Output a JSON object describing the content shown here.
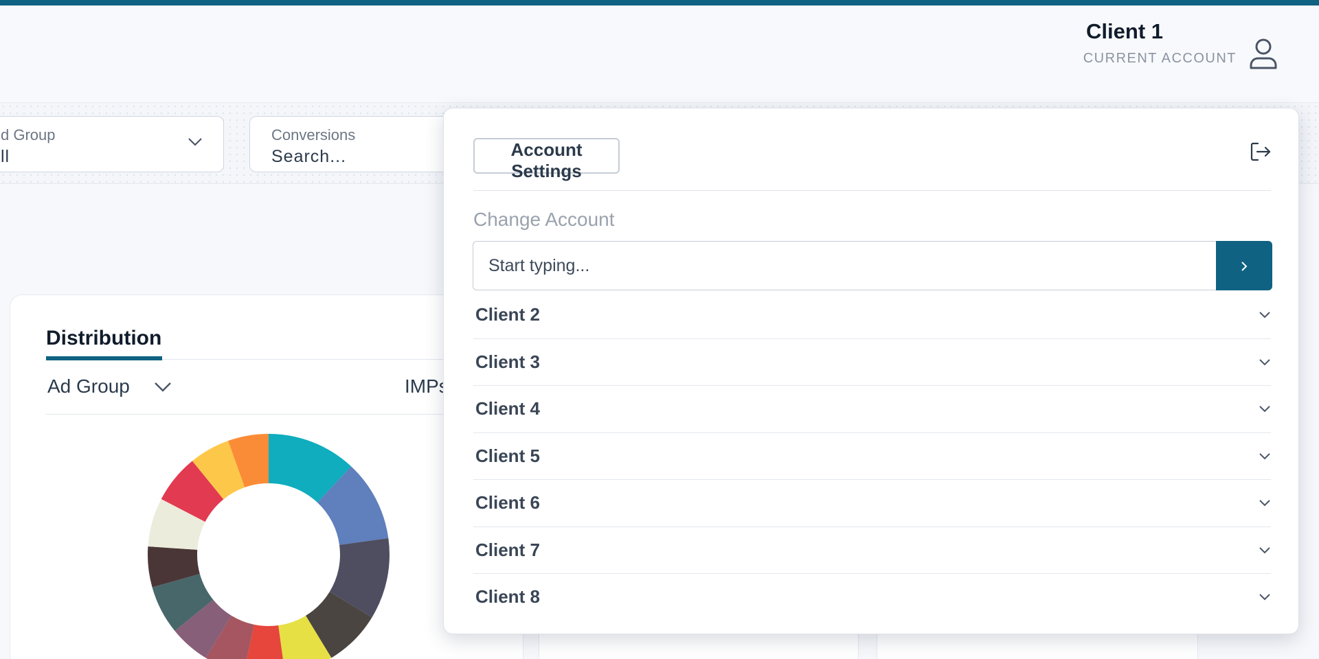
{
  "header": {
    "account_name": "Client 1",
    "account_caption": "CURRENT ACCOUNT",
    "user_icon": "user-icon"
  },
  "filters": {
    "ad_group": {
      "label": "d Group",
      "value": "ll"
    },
    "conversions": {
      "label": "Conversions",
      "placeholder": "Search..."
    }
  },
  "distribution": {
    "title": "Distribution",
    "group_by": "Ad Group",
    "metric_label": "IMPs",
    "chart_data": {
      "type": "pie",
      "hole": true,
      "slices": [
        {
          "value": 11,
          "color": "#0fadbd"
        },
        {
          "value": 10,
          "color": "#5f7fbd"
        },
        {
          "value": 10,
          "color": "#4e4e60"
        },
        {
          "value": 7,
          "color": "#4a4540"
        },
        {
          "value": 6,
          "color": "#e6e045"
        },
        {
          "value": 5,
          "color": "#e6463c"
        },
        {
          "value": 5,
          "color": "#a55660"
        },
        {
          "value": 5,
          "color": "#875f78"
        },
        {
          "value": 6,
          "color": "#48676a"
        },
        {
          "value": 5,
          "color": "#4b3637"
        },
        {
          "value": 6,
          "color": "#ececdc"
        },
        {
          "value": 6,
          "color": "#e23a50"
        },
        {
          "value": 5,
          "color": "#fdc84a"
        },
        {
          "value": 5,
          "color": "#fb8c37"
        }
      ]
    }
  },
  "account_dropdown": {
    "settings_label": "Account Settings",
    "logout_icon": "logout-icon",
    "change_title": "Change Account",
    "search_placeholder": "Start typing...",
    "go_icon": "chevron-right-icon",
    "clients": [
      "Client 2",
      "Client 3",
      "Client 4",
      "Client 5",
      "Client 6",
      "Client 7",
      "Client 8"
    ]
  },
  "colors": {
    "accent": "#0f6282",
    "text_dark": "#111c2b",
    "text_muted": "#8b94a2"
  }
}
